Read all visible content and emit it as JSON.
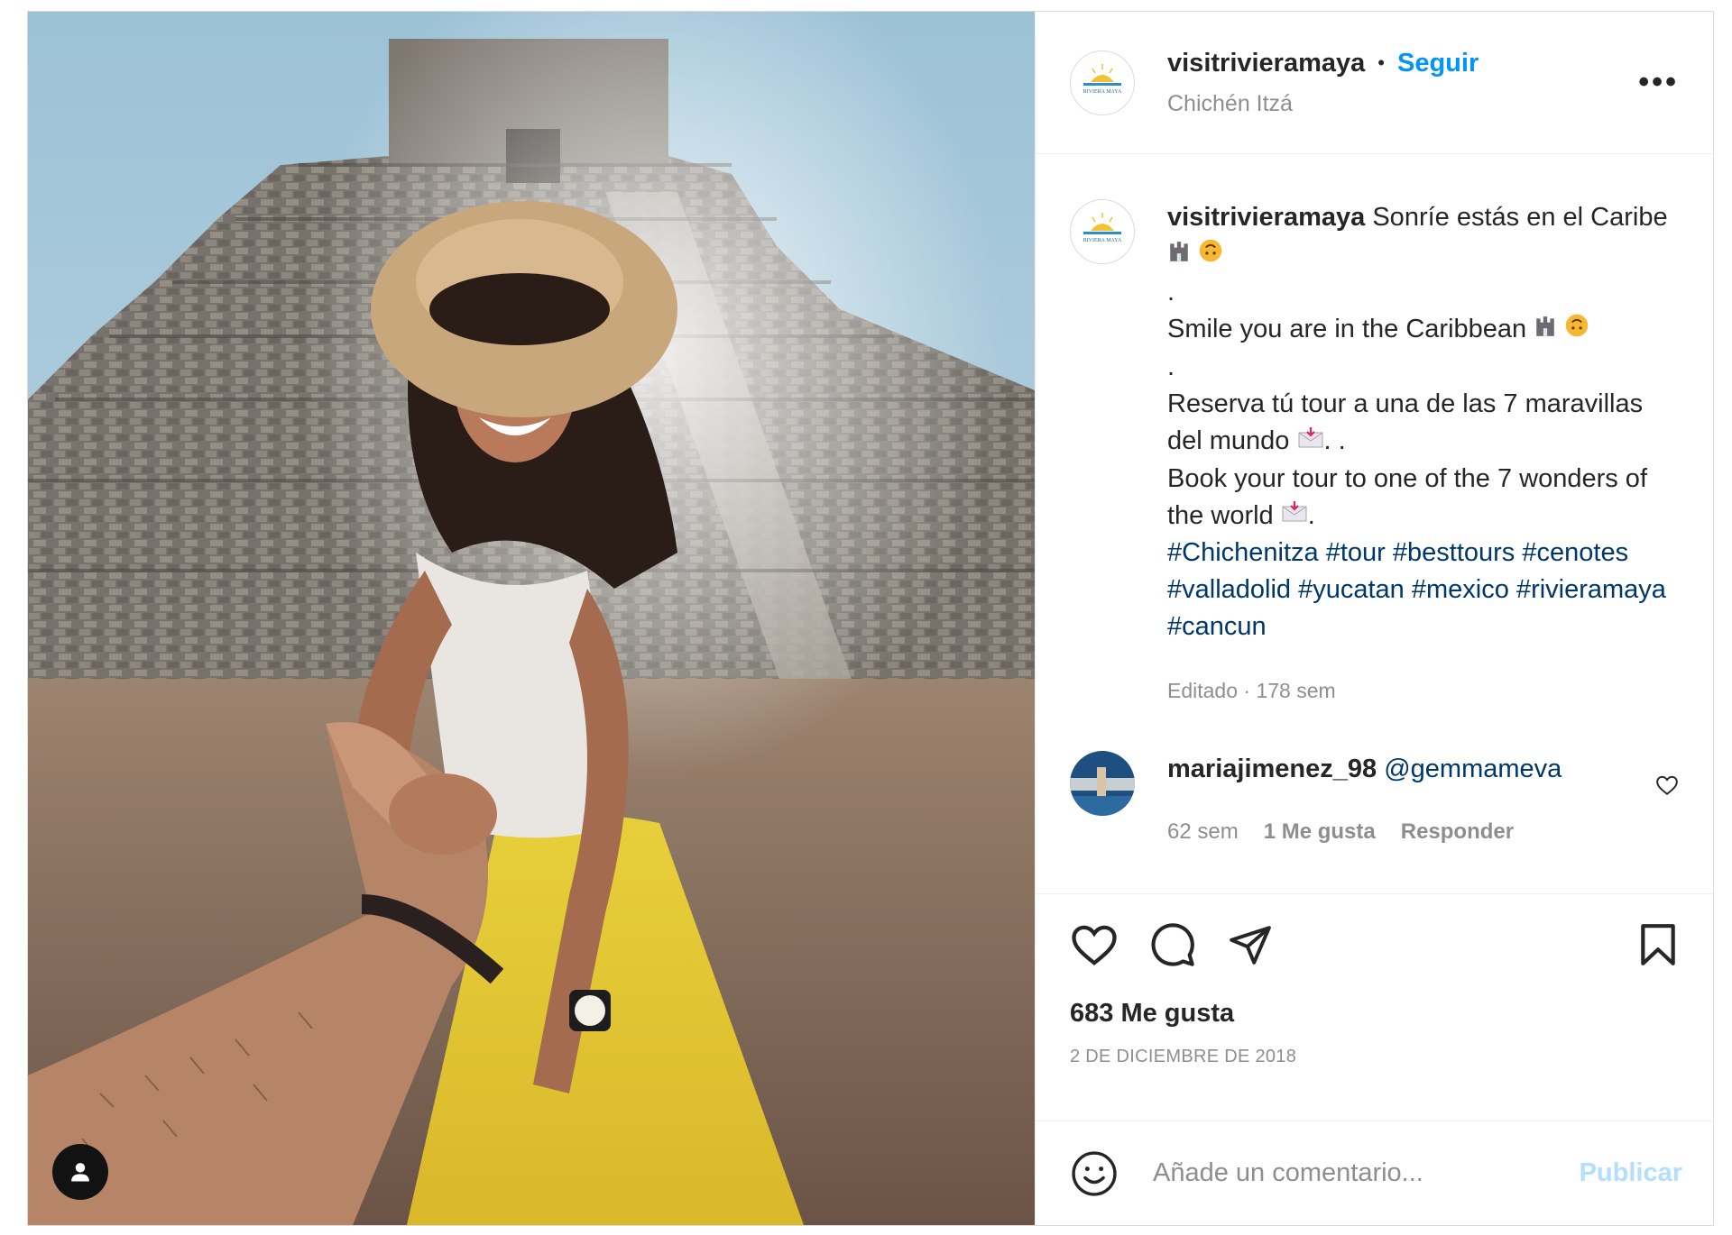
{
  "post": {
    "author": {
      "username": "visitrivieramaya",
      "follow_label": "Seguir",
      "location": "Chichén Itzá",
      "logo_text": "RIVIERA MAYA"
    },
    "more_icon": "more-horizontal-icon",
    "caption": {
      "username": "visitrivieramaya",
      "line1": "Sonríe estás en el Caribe",
      "sep1": ".",
      "line2": "Smile you are in the Caribbean",
      "sep2": ".",
      "line3": "Reserva tú tour a una de las 7 maravillas del mundo",
      "line3_suffix": ". .",
      "line4": "Book your tour to one of the 7 wonders of the world",
      "line4_suffix": ".",
      "hashtags": [
        "#Chichenitza",
        "#tour",
        "#besttours",
        "#cenotes",
        "#valladolid",
        "#yucatan",
        "#mexico",
        "#rivieramaya",
        "#cancun"
      ],
      "meta": "Editado · 178 sem"
    },
    "comment": {
      "username": "mariajimenez_98",
      "mention": "@gemmameva",
      "time": "62 sem",
      "likes": "1 Me gusta",
      "reply": "Responder"
    },
    "actions": {
      "like_icon": "heart-icon",
      "comment_icon": "comment-icon",
      "share_icon": "paper-plane-icon",
      "save_icon": "bookmark-icon"
    },
    "likes_count": "683 Me gusta",
    "date": "2 DE DICIEMBRE DE 2018",
    "add_comment": {
      "placeholder": "Añade un comentario...",
      "publish_label": "Publicar",
      "emoji_icon": "smiley-icon"
    },
    "colors": {
      "link": "#0095f6",
      "hashtag": "#00376b",
      "muted": "#8e8e8e",
      "publish_disabled": "#b2dffc"
    }
  }
}
